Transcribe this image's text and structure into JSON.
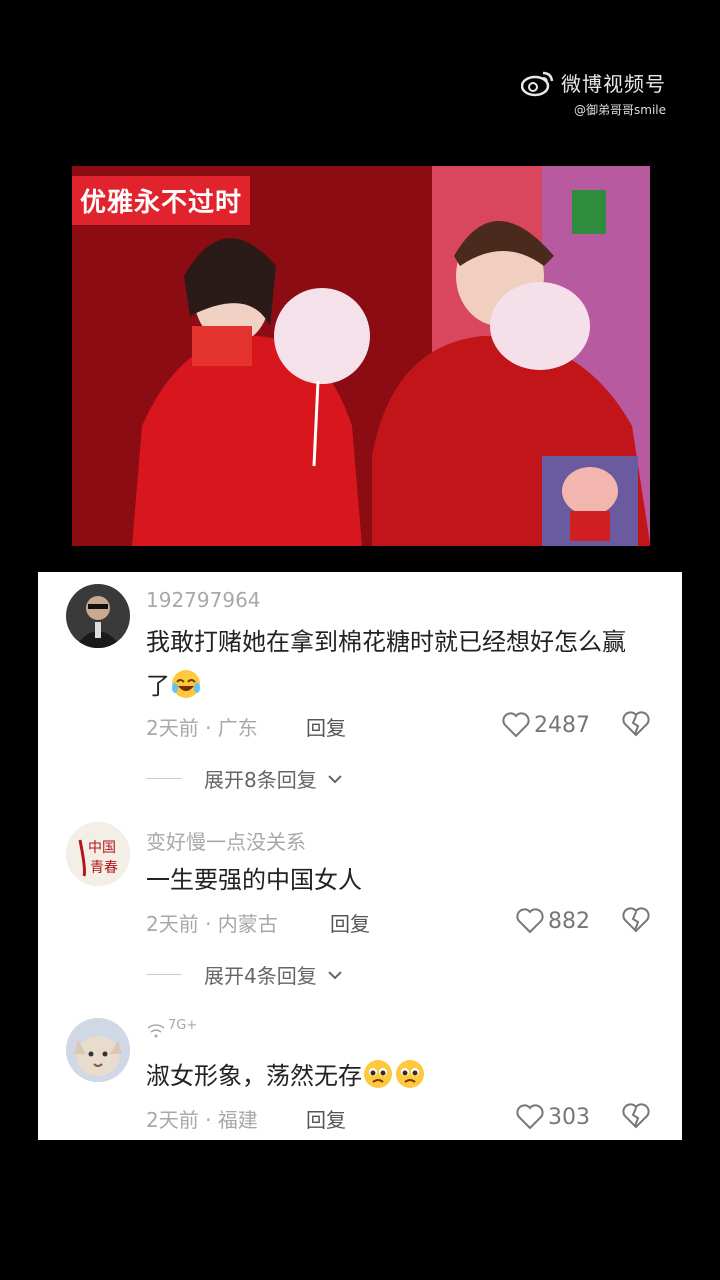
{
  "watermark": {
    "title": "微博视频号",
    "handle": "@御弟哥哥smile"
  },
  "video": {
    "caption": "优雅永不过时"
  },
  "comments": [
    {
      "username": "192797964",
      "text": "我敢打赌她在拿到棉花糖时就已经想好怎么赢了",
      "emoji": "laughing-face",
      "time": "2天前 · 广东",
      "reply": "回复",
      "likes": "2487",
      "expand": "展开8条回复"
    },
    {
      "username": "变好慢一点没关系",
      "text": "一生要强的中国女人",
      "time": "2天前 · 内蒙古",
      "reply": "回复",
      "likes": "882",
      "expand": "展开4条回复"
    },
    {
      "username": "7G+",
      "text": "淑女形象，荡然无存",
      "emoji": "teary-face",
      "time": "2天前 · 福建",
      "reply": "回复",
      "likes": "303"
    }
  ],
  "colors": {
    "caption_bg": "#e1232d",
    "muted_text": "#a8a8a8",
    "main_text": "#222222"
  }
}
